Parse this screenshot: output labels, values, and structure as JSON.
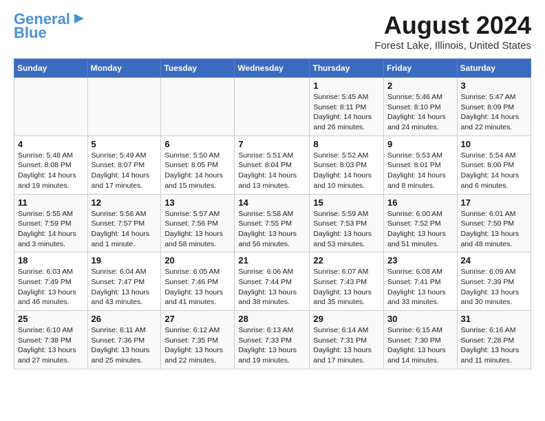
{
  "header": {
    "logo_line1": "General",
    "logo_line2": "Blue",
    "title": "August 2024",
    "location": "Forest Lake, Illinois, United States"
  },
  "columns": [
    "Sunday",
    "Monday",
    "Tuesday",
    "Wednesday",
    "Thursday",
    "Friday",
    "Saturday"
  ],
  "weeks": [
    [
      {
        "day": "",
        "detail": ""
      },
      {
        "day": "",
        "detail": ""
      },
      {
        "day": "",
        "detail": ""
      },
      {
        "day": "",
        "detail": ""
      },
      {
        "day": "1",
        "detail": "Sunrise: 5:45 AM\nSunset: 8:11 PM\nDaylight: 14 hours\nand 26 minutes."
      },
      {
        "day": "2",
        "detail": "Sunrise: 5:46 AM\nSunset: 8:10 PM\nDaylight: 14 hours\nand 24 minutes."
      },
      {
        "day": "3",
        "detail": "Sunrise: 5:47 AM\nSunset: 8:09 PM\nDaylight: 14 hours\nand 22 minutes."
      }
    ],
    [
      {
        "day": "4",
        "detail": "Sunrise: 5:48 AM\nSunset: 8:08 PM\nDaylight: 14 hours\nand 19 minutes."
      },
      {
        "day": "5",
        "detail": "Sunrise: 5:49 AM\nSunset: 8:07 PM\nDaylight: 14 hours\nand 17 minutes."
      },
      {
        "day": "6",
        "detail": "Sunrise: 5:50 AM\nSunset: 8:05 PM\nDaylight: 14 hours\nand 15 minutes."
      },
      {
        "day": "7",
        "detail": "Sunrise: 5:51 AM\nSunset: 8:04 PM\nDaylight: 14 hours\nand 13 minutes."
      },
      {
        "day": "8",
        "detail": "Sunrise: 5:52 AM\nSunset: 8:03 PM\nDaylight: 14 hours\nand 10 minutes."
      },
      {
        "day": "9",
        "detail": "Sunrise: 5:53 AM\nSunset: 8:01 PM\nDaylight: 14 hours\nand 8 minutes."
      },
      {
        "day": "10",
        "detail": "Sunrise: 5:54 AM\nSunset: 8:00 PM\nDaylight: 14 hours\nand 6 minutes."
      }
    ],
    [
      {
        "day": "11",
        "detail": "Sunrise: 5:55 AM\nSunset: 7:59 PM\nDaylight: 14 hours\nand 3 minutes."
      },
      {
        "day": "12",
        "detail": "Sunrise: 5:56 AM\nSunset: 7:57 PM\nDaylight: 14 hours\nand 1 minute."
      },
      {
        "day": "13",
        "detail": "Sunrise: 5:57 AM\nSunset: 7:56 PM\nDaylight: 13 hours\nand 58 minutes."
      },
      {
        "day": "14",
        "detail": "Sunrise: 5:58 AM\nSunset: 7:55 PM\nDaylight: 13 hours\nand 56 minutes."
      },
      {
        "day": "15",
        "detail": "Sunrise: 5:59 AM\nSunset: 7:53 PM\nDaylight: 13 hours\nand 53 minutes."
      },
      {
        "day": "16",
        "detail": "Sunrise: 6:00 AM\nSunset: 7:52 PM\nDaylight: 13 hours\nand 51 minutes."
      },
      {
        "day": "17",
        "detail": "Sunrise: 6:01 AM\nSunset: 7:50 PM\nDaylight: 13 hours\nand 48 minutes."
      }
    ],
    [
      {
        "day": "18",
        "detail": "Sunrise: 6:03 AM\nSunset: 7:49 PM\nDaylight: 13 hours\nand 46 minutes."
      },
      {
        "day": "19",
        "detail": "Sunrise: 6:04 AM\nSunset: 7:47 PM\nDaylight: 13 hours\nand 43 minutes."
      },
      {
        "day": "20",
        "detail": "Sunrise: 6:05 AM\nSunset: 7:46 PM\nDaylight: 13 hours\nand 41 minutes."
      },
      {
        "day": "21",
        "detail": "Sunrise: 6:06 AM\nSunset: 7:44 PM\nDaylight: 13 hours\nand 38 minutes."
      },
      {
        "day": "22",
        "detail": "Sunrise: 6:07 AM\nSunset: 7:43 PM\nDaylight: 13 hours\nand 35 minutes."
      },
      {
        "day": "23",
        "detail": "Sunrise: 6:08 AM\nSunset: 7:41 PM\nDaylight: 13 hours\nand 33 minutes."
      },
      {
        "day": "24",
        "detail": "Sunrise: 6:09 AM\nSunset: 7:39 PM\nDaylight: 13 hours\nand 30 minutes."
      }
    ],
    [
      {
        "day": "25",
        "detail": "Sunrise: 6:10 AM\nSunset: 7:38 PM\nDaylight: 13 hours\nand 27 minutes."
      },
      {
        "day": "26",
        "detail": "Sunrise: 6:11 AM\nSunset: 7:36 PM\nDaylight: 13 hours\nand 25 minutes."
      },
      {
        "day": "27",
        "detail": "Sunrise: 6:12 AM\nSunset: 7:35 PM\nDaylight: 13 hours\nand 22 minutes."
      },
      {
        "day": "28",
        "detail": "Sunrise: 6:13 AM\nSunset: 7:33 PM\nDaylight: 13 hours\nand 19 minutes."
      },
      {
        "day": "29",
        "detail": "Sunrise: 6:14 AM\nSunset: 7:31 PM\nDaylight: 13 hours\nand 17 minutes."
      },
      {
        "day": "30",
        "detail": "Sunrise: 6:15 AM\nSunset: 7:30 PM\nDaylight: 13 hours\nand 14 minutes."
      },
      {
        "day": "31",
        "detail": "Sunrise: 6:16 AM\nSunset: 7:28 PM\nDaylight: 13 hours\nand 11 minutes."
      }
    ]
  ]
}
